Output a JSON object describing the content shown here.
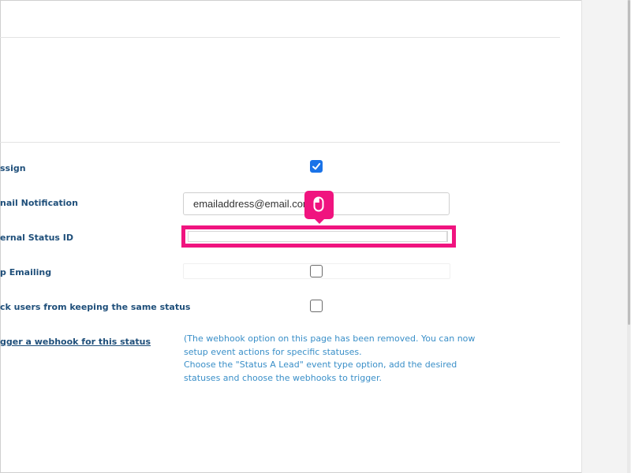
{
  "form": {
    "rows": [
      {
        "label": "ssign",
        "type": "checkbox",
        "checked": true
      },
      {
        "label": "nail Notification",
        "type": "text",
        "value": "emailaddress@email.com"
      },
      {
        "label": "ernal Status ID",
        "type": "text",
        "value": ""
      },
      {
        "label": "p Emailing",
        "type": "checkbox",
        "checked": false
      },
      {
        "label": "ck users from keeping the same status",
        "type": "checkbox",
        "checked": false
      },
      {
        "label": "gger a webhook for this status",
        "type": "link"
      }
    ],
    "webhook_note": [
      "(The webhook option on this page has been removed. You can now",
      "setup event actions for specific statuses.",
      "Choose the \"Status A Lead\" event type option, add the desired",
      "statuses and choose the webhooks to trigger."
    ]
  },
  "colors": {
    "label": "#1f4f7a",
    "note": "#3a8fc8",
    "checkbox_checked": "#1a73e8",
    "highlight": "#f0147f"
  },
  "icons": {
    "checkmark": "checkmark-icon",
    "cursor": "mouse-icon"
  }
}
